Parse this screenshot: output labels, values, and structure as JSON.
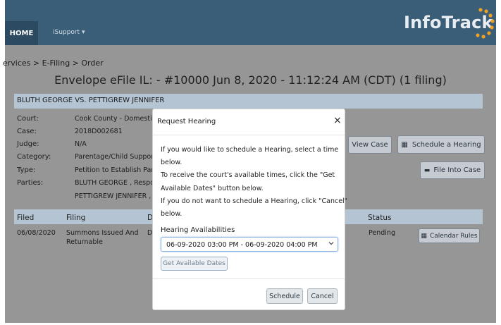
{
  "nav": {
    "home": "HOME",
    "isupport": "iSupport ▾",
    "logo": "InfoTrack"
  },
  "breadcrumb": "ervices > E-Filing > Order",
  "page_title": "Envelope eFile IL: - #10000 Jun 8, 2020 - 11:12:24 AM (CDT) (1 filing)",
  "case": {
    "title": "BLUTH GEORGE VS. PETTIGREW JENNIFER",
    "fields": [
      {
        "label": "Court:",
        "value": "Cook County - Domestic"
      },
      {
        "label": "Case:",
        "value": "2018D002681"
      },
      {
        "label": "Judge:",
        "value": "N/A"
      },
      {
        "label": "Category:",
        "value": "Parentage/Child Support"
      },
      {
        "label": "Type:",
        "value": "Petition to Establish Parentage"
      },
      {
        "label": "Parties:",
        "value": "BLUTH GEORGE , Respondent"
      }
    ],
    "parties_line2": "PETTIGREW JENNIFER , P"
  },
  "actions": {
    "view_case": "View Case",
    "schedule_hearing": "Schedule a Hearing",
    "file_into_case": "File Into Case",
    "calendar_rules": "Calendar Rules"
  },
  "table": {
    "headers": [
      "Filed",
      "Filing",
      "D",
      "Status"
    ],
    "rows": [
      {
        "filed": "06/08/2020",
        "filing_line1": "Summons Issued And",
        "filing_line2": "Returnable",
        "d": "D",
        "status": "Pending"
      }
    ]
  },
  "modal": {
    "title": "Request Hearing",
    "close": "×",
    "lines": [
      "If you would like to schedule a Hearing, select a time",
      "below.",
      "To receive the court's available times, click the \"Get",
      "Available Dates\" button below.",
      "If you do not want to schedule a Hearing, click \"Cancel\"",
      "below."
    ],
    "field_label": "Hearing Availabilities",
    "selected": "06-09-2020 03:00 PM - 06-09-2020 04:00 PM",
    "get_dates": "Get Available Dates",
    "schedule": "Schedule",
    "cancel": "Cancel"
  },
  "colors": {
    "navbar": "#3a5e78",
    "section_header": "#b8c8d8",
    "logo_dots": "#f0a020"
  }
}
